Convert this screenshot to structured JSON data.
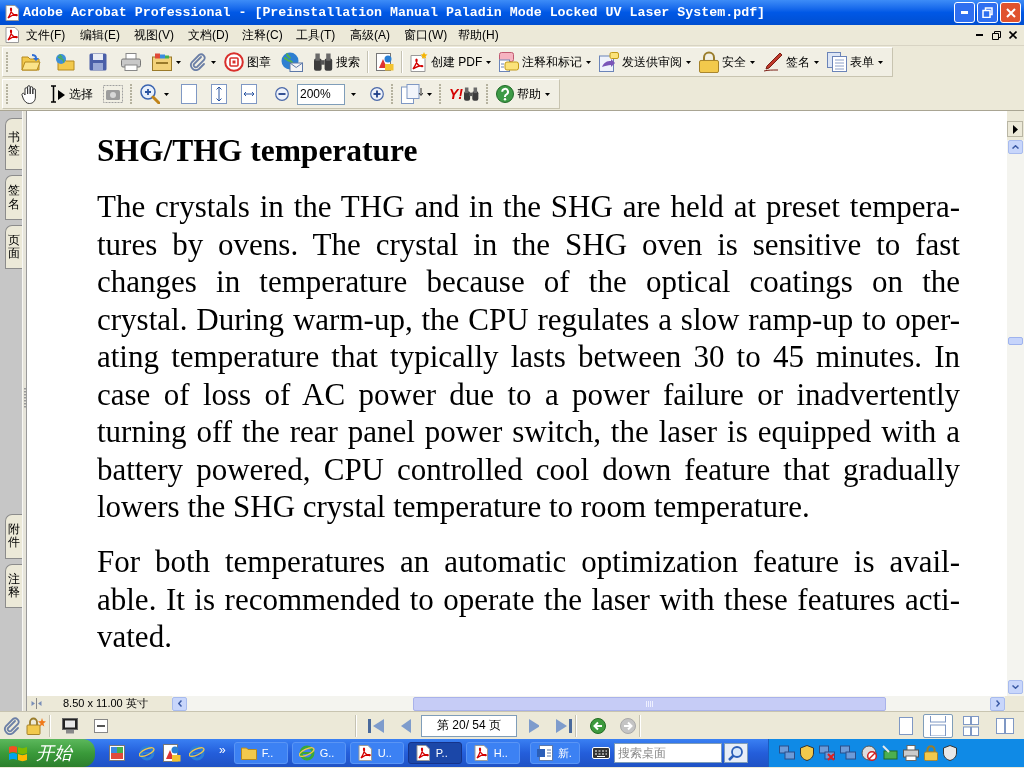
{
  "window": {
    "title": "Adobe Acrobat Professional - [Preinstallation Manual Paladin Mode Locked UV Laser System.pdf]"
  },
  "menu_bar": {
    "items": [
      "文件(F)",
      "编辑(E)",
      "视图(V)",
      "文档(D)",
      "注释(C)",
      "工具(T)",
      "高级(A)",
      "窗口(W)",
      "帮助(H)"
    ]
  },
  "toolbar_1": {
    "labels": [
      "图章",
      "搜索",
      "创建 PDF",
      "注释和标记",
      "发送供审阅",
      "安全",
      "签名",
      "表单"
    ]
  },
  "toolbar_2": {
    "labels": [
      "选择",
      "帮助"
    ],
    "logo_text": "Y!",
    "zoom_field": {
      "value": "200%"
    }
  },
  "navigation_tabs": {
    "top": [
      "书签",
      "签名",
      "页面"
    ],
    "bottom": [
      "附件",
      "注释"
    ]
  },
  "document": {
    "heading": "SHG/THG temperature",
    "paragraphs": [
      {
        "lines": [
          "The crystals in the THG and in the SHG are held at preset tempera-",
          "tures by ovens. The crystal in the SHG oven is sensitive to fast",
          "changes in temperature because of the optical coatings on the",
          "crystal. During warm-up, the CPU regulates a slow ramp-up to oper-",
          "ating temperature that typically lasts between 30 to 45 minutes. In",
          "case of loss of AC power due to a power failure or inadvertently",
          "turning off the rear panel power switch, the laser is equipped with a",
          "battery powered, CPU controlled cool down feature that gradually",
          "lowers the SHG crystal temperature to room temperature."
        ]
      },
      {
        "lines": [
          "For both temperatures an automatic optimization feature is avail-",
          "able. It is recommended to operate the laser with these features acti-",
          "vated."
        ]
      }
    ]
  },
  "horizontal_bar": {
    "page_size": "8.50 x 11.00 英寸"
  },
  "status_bar": {
    "page_field": {
      "value": "第 20/ 54 页"
    },
    "history_buttons": [
      {
        "disabled": false
      },
      {
        "disabled": true
      }
    ],
    "layout_buttons": [
      {
        "selected": false
      },
      {
        "selected": true
      },
      {
        "selected": false
      },
      {
        "selected": false
      }
    ]
  },
  "taskbar": {
    "start_label": "开始",
    "quick_launch_more": "»",
    "tasks": [
      {
        "label": "F..",
        "selected": false
      },
      {
        "label": "G..",
        "selected": false
      },
      {
        "label": "U..",
        "selected": false
      },
      {
        "label": "P..",
        "selected": true
      },
      {
        "label": "H..",
        "selected": false
      },
      {
        "label": "新.",
        "selected": false
      }
    ],
    "search": {
      "placeholder": "搜索桌面"
    }
  }
}
